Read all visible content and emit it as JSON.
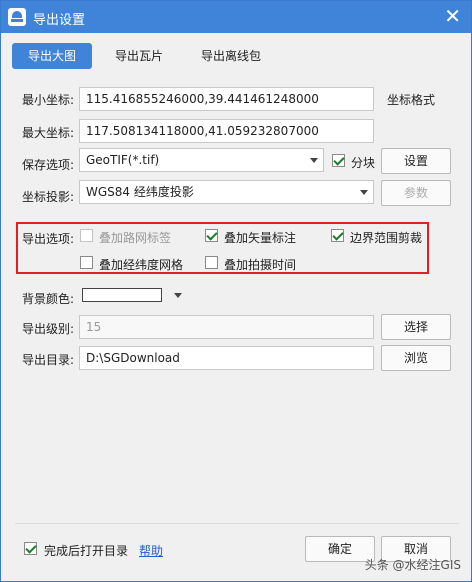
{
  "window": {
    "title": "导出设置",
    "close_glyph": "✕"
  },
  "tabs": [
    {
      "label": "导出大图",
      "active": true
    },
    {
      "label": "导出瓦片",
      "active": false
    },
    {
      "label": "导出离线包",
      "active": false
    }
  ],
  "coords": {
    "min_label": "最小坐标:",
    "min_value": "115.416855246000,39.441461248000",
    "format_label": "坐标格式",
    "max_label": "最大坐标:",
    "max_value": "117.508134118000,41.059232807000"
  },
  "save": {
    "label": "保存选项:",
    "value": "GeoTIF(*.tif)",
    "tile_label": "分块",
    "tile_checked": true,
    "settings_button": "设置"
  },
  "projection": {
    "label": "坐标投影:",
    "value": "WGS84 经纬度投影",
    "params_button": "参数"
  },
  "export_options": {
    "label": "导出选项:",
    "items": [
      {
        "label": "叠加路网标签",
        "checked": false,
        "disabled": true
      },
      {
        "label": "叠加矢量标注",
        "checked": true,
        "disabled": false
      },
      {
        "label": "边界范围剪裁",
        "checked": true,
        "disabled": false
      },
      {
        "label": "叠加经纬度网格",
        "checked": false,
        "disabled": false
      },
      {
        "label": "叠加拍摄时间",
        "checked": false,
        "disabled": false
      }
    ]
  },
  "background": {
    "label": "背景颜色:",
    "color": "#ffffff"
  },
  "level": {
    "label": "导出级别:",
    "value": "15",
    "button": "选择"
  },
  "directory": {
    "label": "导出目录:",
    "value": "D:\\SGDownload",
    "button": "浏览"
  },
  "footer": {
    "open_after_label": "完成后打开目录",
    "open_after_checked": true,
    "help_link": "帮助",
    "ok_button": "确定",
    "cancel_button": "取消"
  },
  "watermark": "头条 @水经注GIS",
  "colors": {
    "title_bar": "#3f84d8",
    "highlight_box": "#e02020",
    "link": "#2360c8"
  }
}
